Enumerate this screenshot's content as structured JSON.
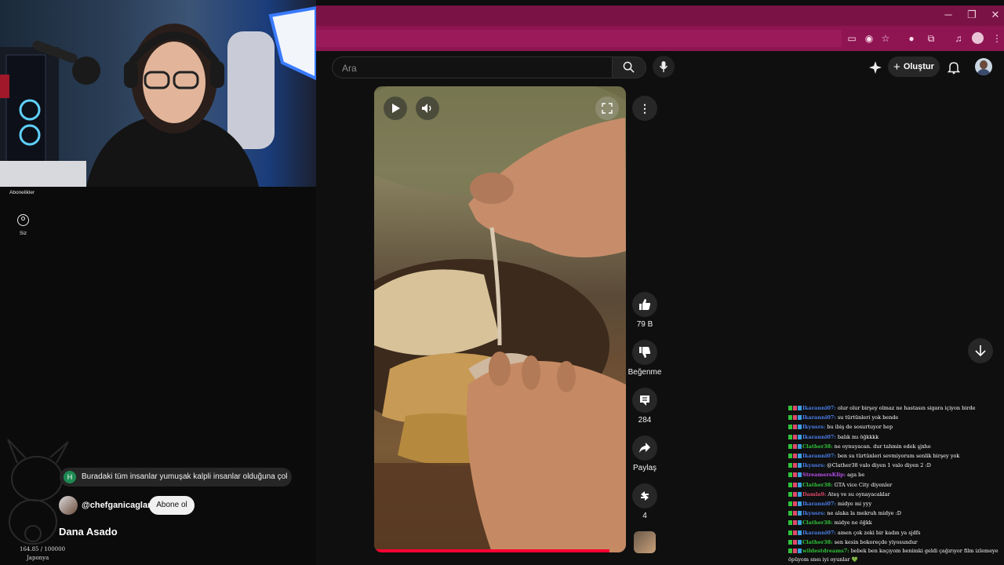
{
  "browser": {
    "window_controls": {
      "minimize": "─",
      "restore": "❐",
      "close": "✕"
    }
  },
  "left_nav": {
    "subscriptions_label": "Abonelikler",
    "you_label": "Siz"
  },
  "overlay": {
    "counter": "164.85 / 100000",
    "country": "Japonya"
  },
  "search": {
    "placeholder": "Ara"
  },
  "header": {
    "create_label": "Oluştur"
  },
  "shorts": {
    "comment_preview": {
      "avatar_letter": "H",
      "text": "Buradaki tüm insanlar yumuşak kalpli insanlar olduğuna çok ..."
    },
    "channel": "@chefganicaglar",
    "subscribe_label": "Abone ol",
    "title": "Dana Asado",
    "likes": "79 B",
    "dislike_label": "Beğenme",
    "comments": "284",
    "share_label": "Paylaş",
    "remix_count": "4"
  },
  "chat": [
    {
      "user": "Ikaranni07:",
      "color": "#4a7ee8",
      "msg": "olur olur birşey olmaz ne hastasın sigara içiyon birde"
    },
    {
      "user": "Ikaranni07:",
      "color": "#4a7ee8",
      "msg": "su türtünleri yok bende"
    },
    {
      "user": "Ikyusrs:",
      "color": "#4a7ee8",
      "msg": "bu ibiş de sosurtuyor hep"
    },
    {
      "user": "Ikaranni07:",
      "color": "#4a7ee8",
      "msg": "balık mı öğkkkk"
    },
    {
      "user": "Clather38:",
      "color": "#2fc23a",
      "msg": "ne oynuyacan. dur tahmin edek şjxhe"
    },
    {
      "user": "Ikaranni07:",
      "color": "#4a7ee8",
      "msg": "ben su türtünleri sevmiyorum senlik birşey yok"
    },
    {
      "user": "Ikyusrs:",
      "color": "#4a7ee8",
      "msg": "@Clather38 valo diyen 1 valo diyen 2 :D"
    },
    {
      "user": "StreamersKlip:",
      "color": "#b84ee8",
      "msg": "aga be"
    },
    {
      "user": "Clather38:",
      "color": "#2fc23a",
      "msg": "GTA vice City diyenler"
    },
    {
      "user": "Damla9:",
      "color": "#e04a6a",
      "msg": "Ateş ve su oynayacaklar"
    },
    {
      "user": "Ikaranni07:",
      "color": "#4a7ee8",
      "msg": "midye mi yyy"
    },
    {
      "user": "Ikyusrs:",
      "color": "#4a7ee8",
      "msg": "ne alaka la mekruh midye :D"
    },
    {
      "user": "Clather38:",
      "color": "#2fc23a",
      "msg": "midye ne öğkk"
    },
    {
      "user": "Ikaranni07:",
      "color": "#4a7ee8",
      "msg": "amen çok zeki bir kadın ya sjdfs"
    },
    {
      "user": "Clather38:",
      "color": "#2fc23a",
      "msg": "sen kesin bokoreçde yiyosundur"
    },
    {
      "user": "wildestdreams7:",
      "color": "#2fc23a",
      "msg": "bebek ben kaçıyom benimki geldi çağırıyor film izlemeye öpüyom sneı iyi oyunlar 💚"
    }
  ]
}
